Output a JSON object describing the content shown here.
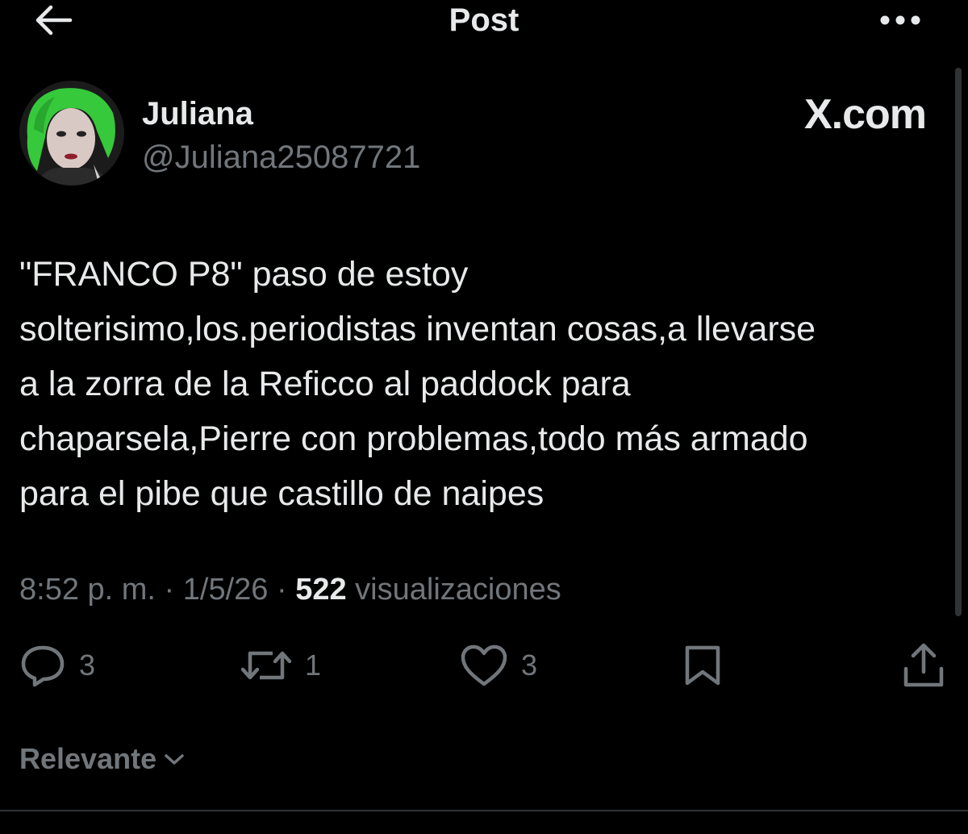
{
  "header": {
    "title": "Post",
    "back_icon": "arrow-left-icon",
    "more_icon": "more-horizontal-icon"
  },
  "author": {
    "display_name": "Juliana",
    "handle": "@Juliana25087721",
    "avatar_icon": "avatar-image"
  },
  "watermark": "X.com",
  "post": {
    "text": "\"FRANCO P8\" paso de estoy\nsolterisimo,los.periodistas inventan cosas,a llevarse\na la zorra de la Reficco al paddock para\nchaparsela,Pierre con problemas,todo más armado\npara el pibe que castillo de naipes"
  },
  "meta": {
    "time": "8:52 p. m.",
    "sep1": " · ",
    "date": "1/5/26",
    "sep2": " · ",
    "views_count": "522",
    "views_label": " visualizaciones"
  },
  "actions": {
    "replies": "3",
    "reposts": "1",
    "likes": "3",
    "bookmark_icon": "bookmark-icon",
    "share_icon": "share-icon"
  },
  "sort": {
    "label": "Relevante"
  },
  "colors": {
    "background": "#000000",
    "text_primary": "#e7e9ea",
    "text_secondary": "#71767b",
    "avatar_hair": "#35c83a"
  }
}
